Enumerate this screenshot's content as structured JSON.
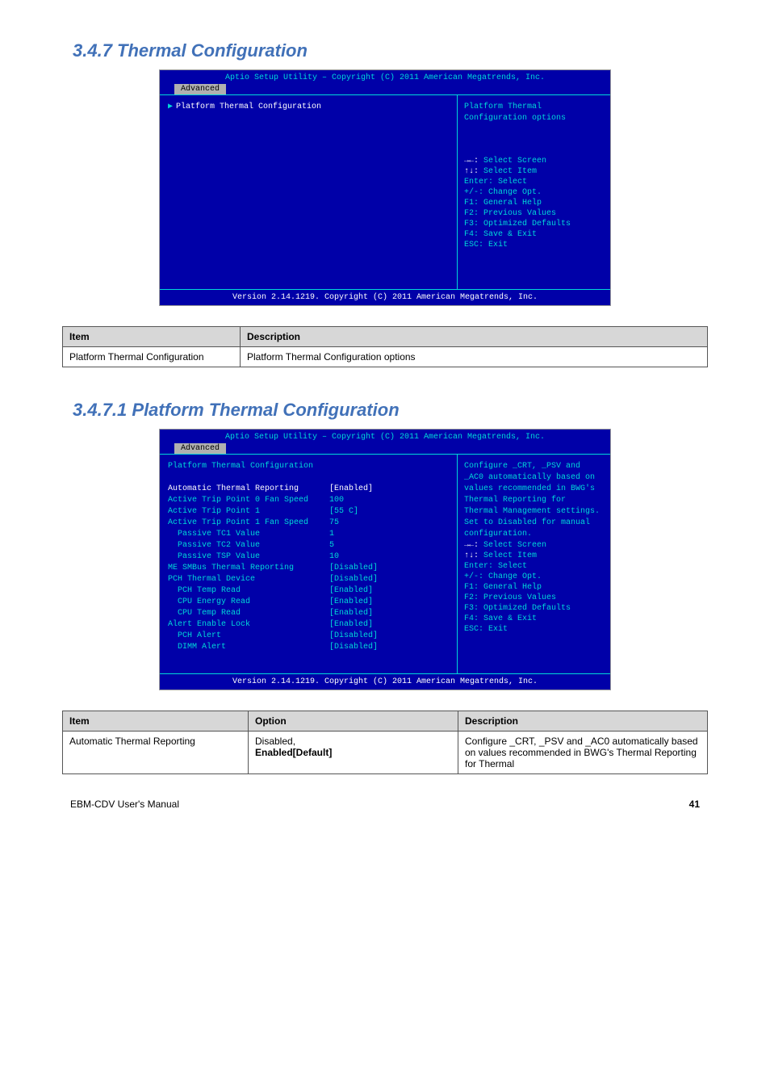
{
  "heading1": "3.4.7  Thermal Configuration",
  "heading2": "3.4.7.1  Platform Thermal Configuration",
  "bios1": {
    "header": "Aptio Setup Utility – Copyright (C) 2011 American Megatrends, Inc.",
    "tab": "Advanced",
    "item": "Platform Thermal Configuration",
    "helpTop": "Platform Thermal Configuration options",
    "help": [
      {
        "k": "→←: ",
        "v": "Select Screen"
      },
      {
        "k": "↑↓: ",
        "v": "Select Item"
      },
      {
        "k": "Enter: ",
        "v": "Select"
      },
      {
        "k": "+/-: ",
        "v": "Change Opt."
      },
      {
        "k": "F1: ",
        "v": "General Help"
      },
      {
        "k": "F2: ",
        "v": "Previous Values"
      },
      {
        "k": "F3: ",
        "v": "Optimized Defaults"
      },
      {
        "k": "F4: ",
        "v": "Save & Exit"
      },
      {
        "k": "ESC: ",
        "v": "Exit"
      }
    ],
    "footer": "Version 2.14.1219. Copyright (C) 2011 American Megatrends, Inc."
  },
  "table1": {
    "h1": "Item",
    "h2": "Description",
    "rows": [
      {
        "c1": "Platform Thermal Configuration",
        "c2": "Platform Thermal Configuration options"
      }
    ]
  },
  "bios2": {
    "header": "Aptio Setup Utility – Copyright (C) 2011 American Megatrends, Inc.",
    "tab": "Advanced",
    "title": "Platform Thermal Configuration",
    "rows": [
      {
        "label": "Automatic Thermal Reporting",
        "value": "[Enabled]",
        "cls": "white"
      },
      {
        "label": "Active Trip Point 0 Fan Speed",
        "value": "100"
      },
      {
        "label": "Active Trip Point 1",
        "value": "[55 C]"
      },
      {
        "label": "Active Trip Point 1 Fan Speed",
        "value": "75"
      },
      {
        "label": "  Passive TC1 Value",
        "value": "1"
      },
      {
        "label": "  Passive TC2 Value",
        "value": "5"
      },
      {
        "label": "  Passive TSP Value",
        "value": "10"
      },
      {
        "label": "",
        "value": ""
      },
      {
        "label": "ME SMBus Thermal Reporting",
        "value": "[Disabled]"
      },
      {
        "label": "",
        "value": ""
      },
      {
        "label": "PCH Thermal Device",
        "value": "[Disabled]"
      },
      {
        "label": "  PCH Temp Read",
        "value": "[Enabled]"
      },
      {
        "label": "  CPU Energy Read",
        "value": "[Enabled]"
      },
      {
        "label": "  CPU Temp Read",
        "value": "[Enabled]"
      },
      {
        "label": "Alert Enable Lock",
        "value": "[Enabled]"
      },
      {
        "label": "  PCH Alert",
        "value": "[Disabled]"
      },
      {
        "label": "  DIMM Alert",
        "value": "[Disabled]"
      }
    ],
    "helpTop": "Configure _CRT, _PSV and _AC0 automatically based on values recommended in BWG's Thermal Reporting for Thermal Management settings. Set to Disabled for manual configuration.",
    "footer": "Version 2.14.1219. Copyright (C) 2011 American Megatrends, Inc."
  },
  "table2": {
    "h1": "Item",
    "h2": "Option",
    "h3": "Description",
    "rows": [
      {
        "c1": "Automatic Thermal Reporting",
        "c2a": "Disabled",
        "c2b": "Enabled[Default]",
        "c3": "Configure _CRT, _PSV and _AC0 automatically based on values recommended in BWG's Thermal Reporting for Thermal"
      }
    ]
  },
  "footer": {
    "left": "EBM-CDV User's Manual",
    "right": "41"
  }
}
